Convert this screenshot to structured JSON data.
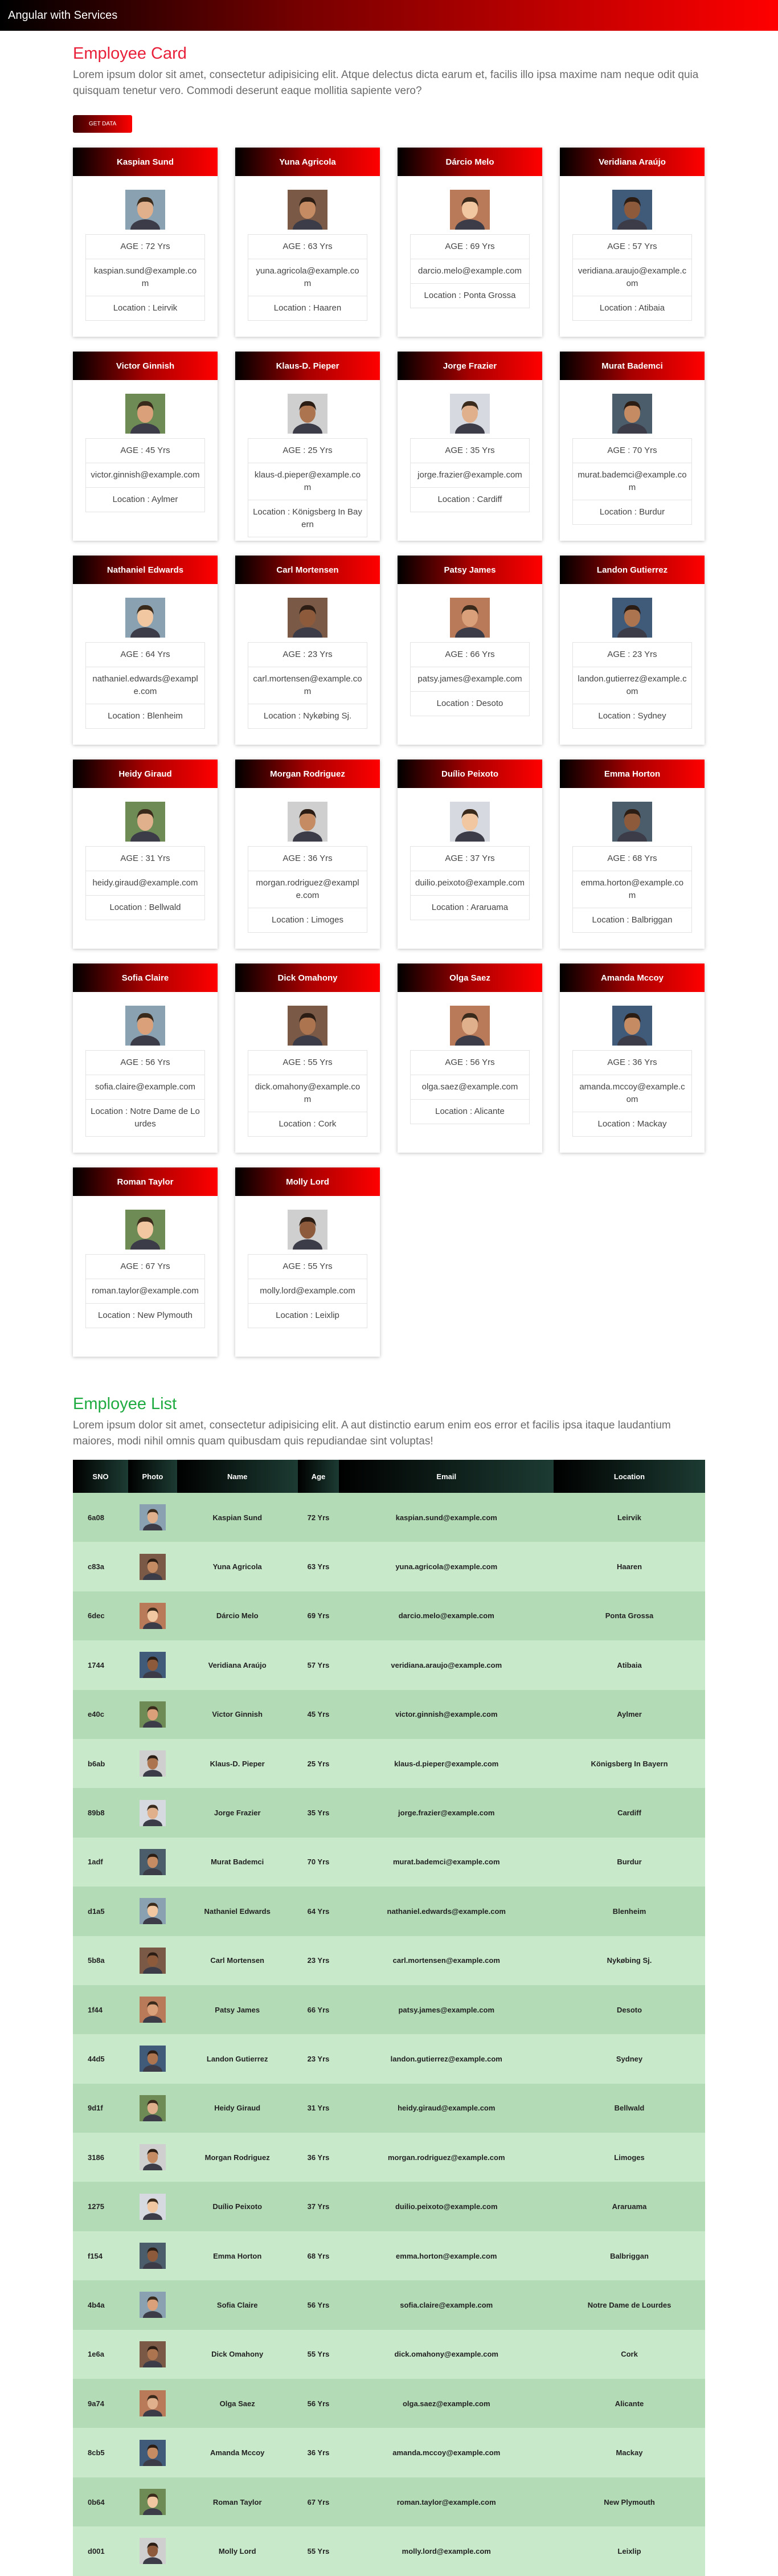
{
  "app": {
    "brand": "Angular with Services"
  },
  "card_section": {
    "title": "Employee Card",
    "description": "Lorem ipsum dolor sit amet, consectetur adipisicing elit. Atque delectus dicta earum et, facilis illo ipsa maxime nam neque odit quia quisquam tenetur vero. Commodi deserunt eaque mollitia sapiente vero?",
    "button_label": "GET DATA"
  },
  "list_section": {
    "title": "Employee List",
    "description": "Lorem ipsum dolor sit amet, consectetur adipisicing elit. A aut distinctio earum enim eos error et facilis ipsa itaque laudantium maiores, modi nihil omnis quam quibusdam quis repudiandae sint voluptas!"
  },
  "table": {
    "headers": [
      "SNO",
      "Photo",
      "Name",
      "Age",
      "Email",
      "Location"
    ]
  },
  "employees": [
    {
      "sno": "6a08",
      "name": "Kaspian Sund",
      "age": "AGE : 72 Yrs",
      "age_short": "72 Yrs",
      "email": "kaspian.sund@example.com",
      "location": "Location : Leirvik",
      "loc": "Leirvik"
    },
    {
      "sno": "c83a",
      "name": "Yuna Agricola",
      "age": "AGE : 63 Yrs",
      "age_short": "63 Yrs",
      "email": "yuna.agricola@example.com",
      "location": "Location : Haaren",
      "loc": "Haaren"
    },
    {
      "sno": "6dec",
      "name": "Dárcio Melo",
      "age": "AGE : 69 Yrs",
      "age_short": "69 Yrs",
      "email": "darcio.melo@example.com",
      "location": "Location : Ponta Grossa",
      "loc": "Ponta Grossa"
    },
    {
      "sno": "1744",
      "name": "Veridiana Araújo",
      "age": "AGE : 57 Yrs",
      "age_short": "57 Yrs",
      "email": "veridiana.araujo@example.com",
      "location": "Location : Atibaia",
      "loc": "Atibaia"
    },
    {
      "sno": "e40c",
      "name": "Victor Ginnish",
      "age": "AGE : 45 Yrs",
      "age_short": "45 Yrs",
      "email": "victor.ginnish@example.com",
      "location": "Location : Aylmer",
      "loc": "Aylmer"
    },
    {
      "sno": "b6ab",
      "name": "Klaus-D. Pieper",
      "age": "AGE : 25 Yrs",
      "age_short": "25 Yrs",
      "email": "klaus-d.pieper@example.com",
      "location": "Location : Königsberg In Bayern",
      "loc": "Königsberg In Bayern"
    },
    {
      "sno": "89b8",
      "name": "Jorge Frazier",
      "age": "AGE : 35 Yrs",
      "age_short": "35 Yrs",
      "email": "jorge.frazier@example.com",
      "location": "Location : Cardiff",
      "loc": "Cardiff"
    },
    {
      "sno": "1adf",
      "name": "Murat Bademci",
      "age": "AGE : 70 Yrs",
      "age_short": "70 Yrs",
      "email": "murat.bademci@example.com",
      "location": "Location : Burdur",
      "loc": "Burdur"
    },
    {
      "sno": "d1a5",
      "name": "Nathaniel Edwards",
      "age": "AGE : 64 Yrs",
      "age_short": "64 Yrs",
      "email": "nathaniel.edwards@example.com",
      "location": "Location : Blenheim",
      "loc": "Blenheim"
    },
    {
      "sno": "5b8a",
      "name": "Carl Mortensen",
      "age": "AGE : 23 Yrs",
      "age_short": "23 Yrs",
      "email": "carl.mortensen@example.com",
      "location": "Location : Nykøbing Sj.",
      "loc": "Nykøbing Sj."
    },
    {
      "sno": "1f44",
      "name": "Patsy James",
      "age": "AGE : 66 Yrs",
      "age_short": "66 Yrs",
      "email": "patsy.james@example.com",
      "location": "Location : Desoto",
      "loc": "Desoto"
    },
    {
      "sno": "44d5",
      "name": "Landon Gutierrez",
      "age": "AGE : 23 Yrs",
      "age_short": "23 Yrs",
      "email": "landon.gutierrez@example.com",
      "location": "Location : Sydney",
      "loc": "Sydney"
    },
    {
      "sno": "9d1f",
      "name": "Heidy Giraud",
      "age": "AGE : 31 Yrs",
      "age_short": "31 Yrs",
      "email": "heidy.giraud@example.com",
      "location": "Location : Bellwald",
      "loc": "Bellwald"
    },
    {
      "sno": "3186",
      "name": "Morgan Rodriguez",
      "age": "AGE : 36 Yrs",
      "age_short": "36 Yrs",
      "email": "morgan.rodriguez@example.com",
      "location": "Location : Limoges",
      "loc": "Limoges"
    },
    {
      "sno": "1275",
      "name": "Duílio Peixoto",
      "age": "AGE : 37 Yrs",
      "age_short": "37 Yrs",
      "email": "duilio.peixoto@example.com",
      "location": "Location : Araruama",
      "loc": "Araruama"
    },
    {
      "sno": "f154",
      "name": "Emma Horton",
      "age": "AGE : 68 Yrs",
      "age_short": "68 Yrs",
      "email": "emma.horton@example.com",
      "location": "Location : Balbriggan",
      "loc": "Balbriggan"
    },
    {
      "sno": "4b4a",
      "name": "Sofia Claire",
      "age": "AGE : 56 Yrs",
      "age_short": "56 Yrs",
      "email": "sofia.claire@example.com",
      "location": "Location : Notre Dame de Lourdes",
      "loc": "Notre Dame de Lourdes"
    },
    {
      "sno": "1e6a",
      "name": "Dick Omahony",
      "age": "AGE : 55 Yrs",
      "age_short": "55 Yrs",
      "email": "dick.omahony@example.com",
      "location": "Location : Cork",
      "loc": "Cork"
    },
    {
      "sno": "9a74",
      "name": "Olga Saez",
      "age": "AGE : 56 Yrs",
      "age_short": "56 Yrs",
      "email": "olga.saez@example.com",
      "location": "Location : Alicante",
      "loc": "Alicante"
    },
    {
      "sno": "8cb5",
      "name": "Amanda Mccoy",
      "age": "AGE : 36 Yrs",
      "age_short": "36 Yrs",
      "email": "amanda.mccoy@example.com",
      "location": "Location : Mackay",
      "loc": "Mackay"
    },
    {
      "sno": "0b64",
      "name": "Roman Taylor",
      "age": "AGE : 67 Yrs",
      "age_short": "67 Yrs",
      "email": "roman.taylor@example.com",
      "location": "Location : New Plymouth",
      "loc": "New Plymouth"
    },
    {
      "sno": "d001",
      "name": "Molly Lord",
      "age": "AGE : 55 Yrs",
      "age_short": "55 Yrs",
      "email": "molly.lord@example.com",
      "location": "Location : Leixlip",
      "loc": "Leixlip"
    }
  ],
  "colors": {
    "accent_red": "#e8203a",
    "accent_green": "#1fab41",
    "row_green": "#b3dbb6"
  }
}
